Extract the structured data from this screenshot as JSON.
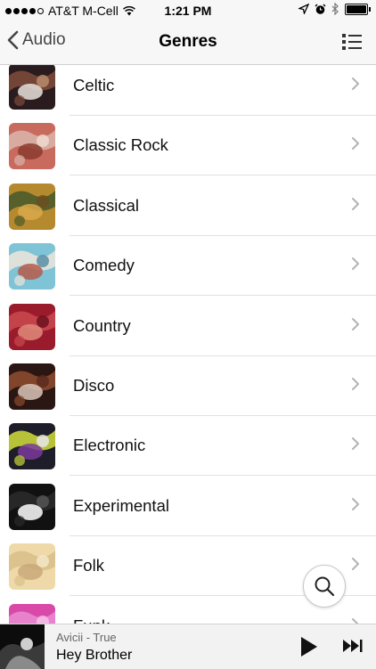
{
  "status_bar": {
    "carrier": "AT&T M-Cell",
    "time": "1:21 PM",
    "icons": [
      "signal-dots-icon",
      "wifi-icon",
      "location-icon",
      "alarm-icon",
      "bluetooth-icon",
      "battery-icon"
    ]
  },
  "nav": {
    "back_label": "Audio",
    "title": "Genres",
    "menu_icon": "list-view-icon"
  },
  "genres": [
    {
      "label": "Celtic",
      "colors": [
        "#2a1c1e",
        "#7a4a3a",
        "#e9e2dc",
        "#b98a6a"
      ]
    },
    {
      "label": "Classic Rock",
      "colors": [
        "#c96a5e",
        "#d9b3a8",
        "#8a3b2e",
        "#efd9cf"
      ]
    },
    {
      "label": "Classical",
      "colors": [
        "#b58a2e",
        "#4c5a2a",
        "#d9a84a",
        "#6b4e1e"
      ]
    },
    {
      "label": "Comedy",
      "colors": [
        "#7fc3d6",
        "#e8e4da",
        "#b55a4a",
        "#5a8fa6"
      ]
    },
    {
      "label": "Country",
      "colors": [
        "#9a1c2c",
        "#c9484e",
        "#e08a7a",
        "#6e1020"
      ]
    },
    {
      "label": "Disco",
      "colors": [
        "#2a1612",
        "#8a4a2e",
        "#d9c6b8",
        "#5c2a1e"
      ]
    },
    {
      "label": "Electronic",
      "colors": [
        "#1e1e2a",
        "#c8d43a",
        "#7a3a9a",
        "#e8e8e8"
      ]
    },
    {
      "label": "Experimental",
      "colors": [
        "#111111",
        "#2a2a2a",
        "#ffffff",
        "#555555"
      ]
    },
    {
      "label": "Folk",
      "colors": [
        "#efd9a8",
        "#d9c08a",
        "#c9a87a",
        "#f5e8c8"
      ]
    },
    {
      "label": "Funk",
      "colors": [
        "#d94aa8",
        "#e88ad0",
        "#9a2a7a",
        "#f2c2e6"
      ]
    }
  ],
  "now_playing": {
    "artist_album": "Avicii - True",
    "song": "Hey Brother",
    "controls": [
      "play-icon",
      "skip-forward-icon"
    ]
  },
  "search_icon": "search-icon"
}
